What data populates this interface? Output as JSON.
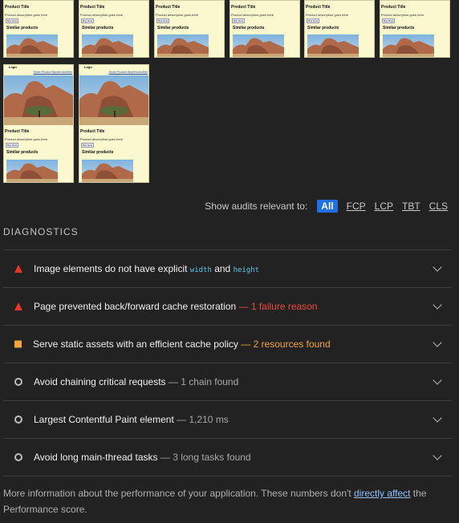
{
  "filmstrip": {
    "product_title": "Product Title",
    "product_description": "Product description goes here",
    "button_label": "Buy Now",
    "similar_label": "Similar products",
    "logo": "Logo",
    "nav_links": "Home  Product  Women  Another"
  },
  "filter": {
    "label": "Show audits relevant to:",
    "chips": [
      "All",
      "FCP",
      "LCP",
      "TBT",
      "CLS"
    ],
    "active": "All"
  },
  "diagnostics": {
    "title": "DIAGNOSTICS",
    "audits": [
      {
        "icon": "fail-triangle-icon",
        "text_before": "Image elements do not have explicit ",
        "code1": "width",
        "and": " and ",
        "code2": "height"
      },
      {
        "icon": "fail-triangle-icon",
        "text": "Page prevented back/forward cache restoration",
        "detail": " — 1 failure reason"
      },
      {
        "icon": "warning-square-icon",
        "text": "Serve static assets with an efficient cache policy",
        "detail": " — 2 resources found"
      },
      {
        "icon": "info-circle-icon",
        "text": "Avoid chaining critical requests",
        "detail": " — 1 chain found"
      },
      {
        "icon": "info-circle-icon",
        "text": "Largest Contentful Paint element",
        "detail": " — 1,210 ms"
      },
      {
        "icon": "info-circle-icon",
        "text": "Avoid long main-thread tasks",
        "detail": " — 3 long tasks found"
      }
    ]
  },
  "footer": {
    "text_before": "More information about the performance of your application. These numbers don't ",
    "link": "directly affect",
    "text_after": " the Performance score."
  },
  "colors": {
    "fail": "#e8352a",
    "warn": "#f4a43a",
    "accent": "#1f6fe5",
    "code": "#5ec3e8"
  }
}
